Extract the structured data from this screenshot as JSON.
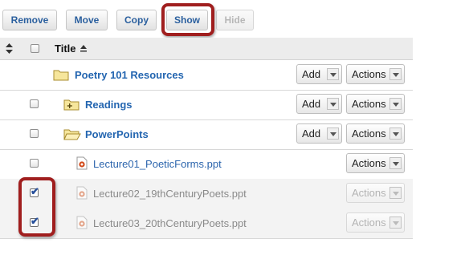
{
  "toolbar": {
    "remove": "Remove",
    "move": "Move",
    "copy": "Copy",
    "show": "Show",
    "hide": "Hide"
  },
  "header": {
    "title": "Title"
  },
  "rows": [
    {
      "name": "Poetry 101 Resources",
      "add": "Add",
      "actions": "Actions"
    },
    {
      "name": "Readings",
      "add": "Add",
      "actions": "Actions"
    },
    {
      "name": "PowerPoints",
      "add": "Add",
      "actions": "Actions"
    },
    {
      "name": "Lecture01_PoeticForms.ppt",
      "actions": "Actions"
    },
    {
      "name": "Lecture02_19thCenturyPoets.ppt",
      "actions": "Actions",
      "checked": true
    },
    {
      "name": "Lecture03_20thCenturyPoets.ppt",
      "actions": "Actions",
      "checked": true
    }
  ],
  "colors": {
    "link": "#2365b0",
    "highlight": "#a01e1e"
  }
}
